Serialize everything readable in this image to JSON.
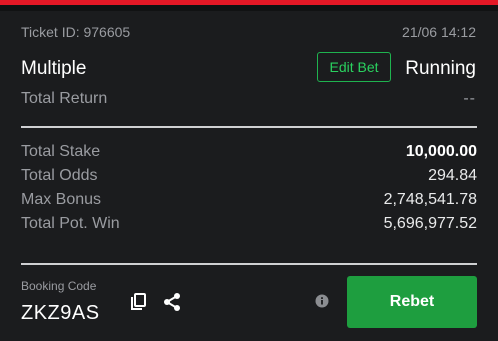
{
  "ticket": {
    "id_text": "Ticket ID: 976605",
    "date_time": "21/06 14:12",
    "bet_type": "Multiple",
    "edit_label": "Edit Bet",
    "status": "Running",
    "total_return_label": "Total Return",
    "total_return_value": "--"
  },
  "summary": {
    "rows": [
      {
        "label": "Total Stake",
        "value": "10,000.00"
      },
      {
        "label": "Total Odds",
        "value": "294.84"
      },
      {
        "label": "Max Bonus",
        "value": "2,748,541.78"
      },
      {
        "label": "Total Pot. Win",
        "value": "5,696,977.52"
      }
    ]
  },
  "booking": {
    "label": "Booking Code",
    "code": "ZKZ9AS",
    "icons": [
      "copy-icon",
      "share-icon",
      "info-icon"
    ]
  },
  "actions": {
    "rebet_label": "Rebet"
  },
  "colors": {
    "accent_red": "#e41826",
    "accent_green": "#1e9e3f",
    "edit_green": "#2ad15f",
    "background": "#1b1c1e"
  }
}
